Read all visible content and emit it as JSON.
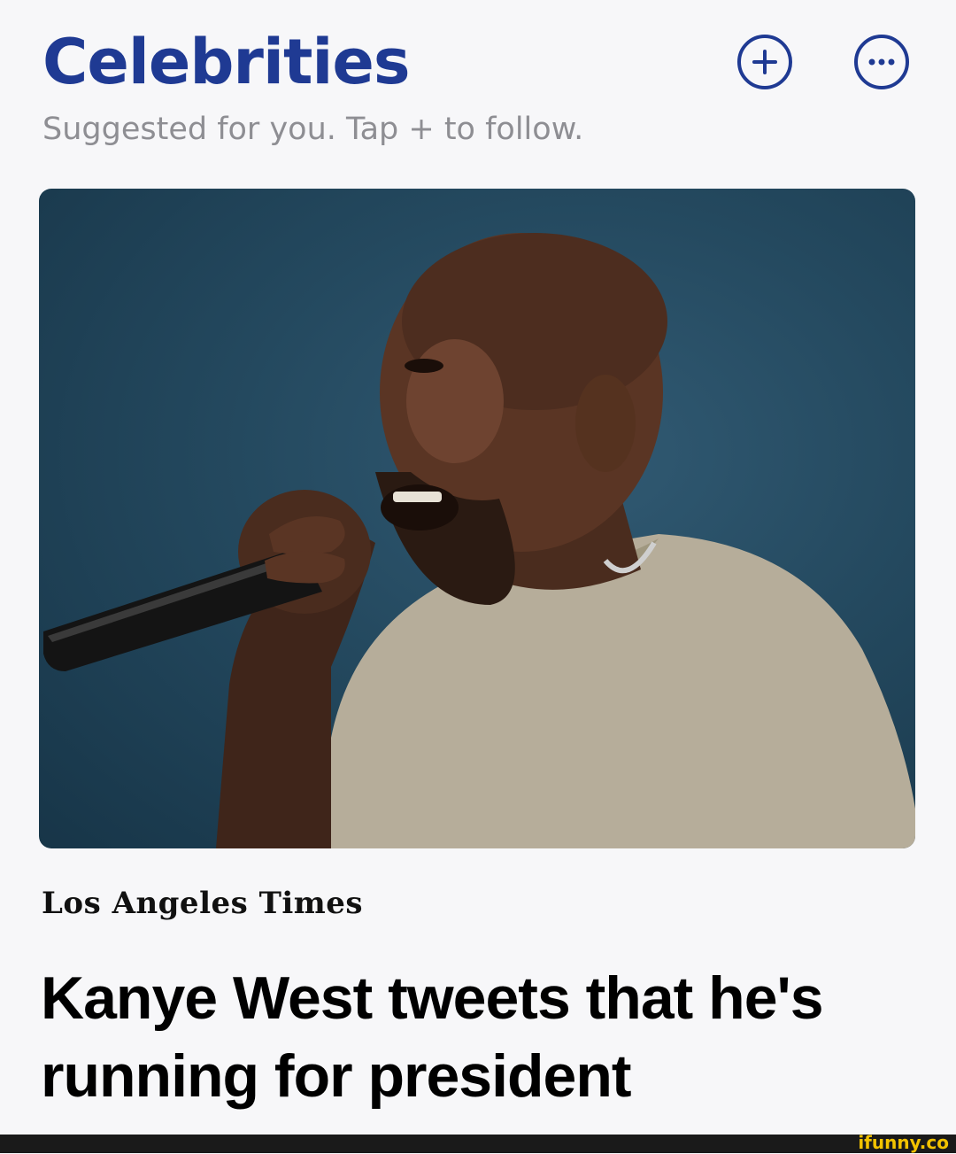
{
  "header": {
    "title": "Celebrities",
    "subtitle": "Suggested for you. Tap + to follow."
  },
  "icons": {
    "follow": "plus-circle-icon",
    "more": "ellipsis-circle-icon"
  },
  "colors": {
    "accent": "#1f3a93",
    "subtitle": "#8e8e93",
    "background": "#f7f7f9",
    "watermark": "#f2c200"
  },
  "article": {
    "source": "Los Angeles Times",
    "headline": "Kanye West tweets that he's running for president"
  },
  "watermark": "ifunny.co"
}
